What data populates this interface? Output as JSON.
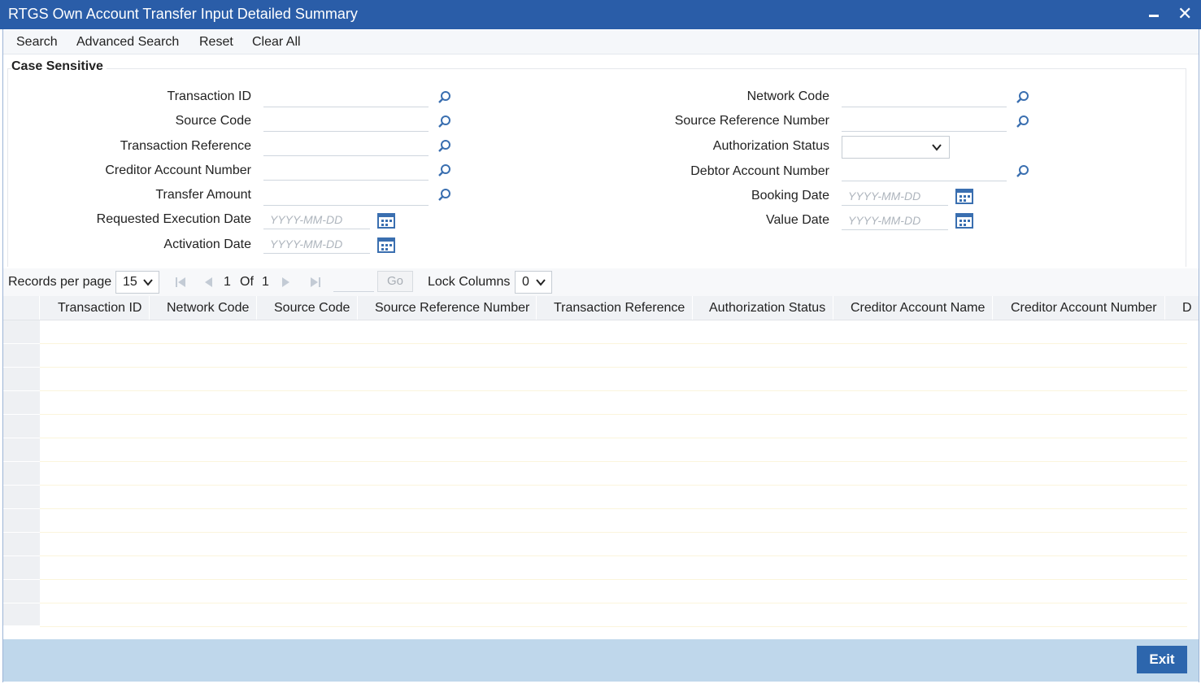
{
  "window": {
    "title": "RTGS Own Account Transfer Input Detailed Summary"
  },
  "toolbar": {
    "search": "Search",
    "advanced_search": "Advanced Search",
    "reset": "Reset",
    "clear_all": "Clear All"
  },
  "form": {
    "legend": "Case Sensitive",
    "left_fields": [
      {
        "label": "Transaction ID"
      },
      {
        "label": "Source Code"
      },
      {
        "label": "Transaction Reference"
      },
      {
        "label": "Creditor Account Number"
      },
      {
        "label": "Transfer Amount"
      },
      {
        "label": "Requested Execution Date",
        "placeholder": "YYYY-MM-DD"
      },
      {
        "label": "Activation Date",
        "placeholder": "YYYY-MM-DD"
      }
    ],
    "right_fields": [
      {
        "label": "Network Code"
      },
      {
        "label": "Source Reference Number"
      },
      {
        "label": "Authorization Status",
        "value": ""
      },
      {
        "label": "Debtor Account Number"
      },
      {
        "label": "Booking Date",
        "placeholder": "YYYY-MM-DD"
      },
      {
        "label": "Value Date",
        "placeholder": "YYYY-MM-DD"
      }
    ]
  },
  "pager": {
    "records_label": "Records per page",
    "records_value": "15",
    "current_page": "1",
    "of_label": "Of",
    "total_pages": "1",
    "go_label": "Go",
    "lock_label": "Lock Columns",
    "lock_value": "0"
  },
  "grid": {
    "columns": [
      "Transaction ID",
      "Network Code",
      "Source Code",
      "Source Reference Number",
      "Transaction Reference",
      "Authorization Status",
      "Creditor Account Name",
      "Creditor Account Number",
      "D"
    ],
    "rows": []
  },
  "footer": {
    "exit_label": "Exit"
  },
  "colors": {
    "titlebar": "#2a5da8",
    "footer": "#bfd7eb",
    "exit_button": "#2d66ad",
    "icon": "#3a6fb0"
  }
}
